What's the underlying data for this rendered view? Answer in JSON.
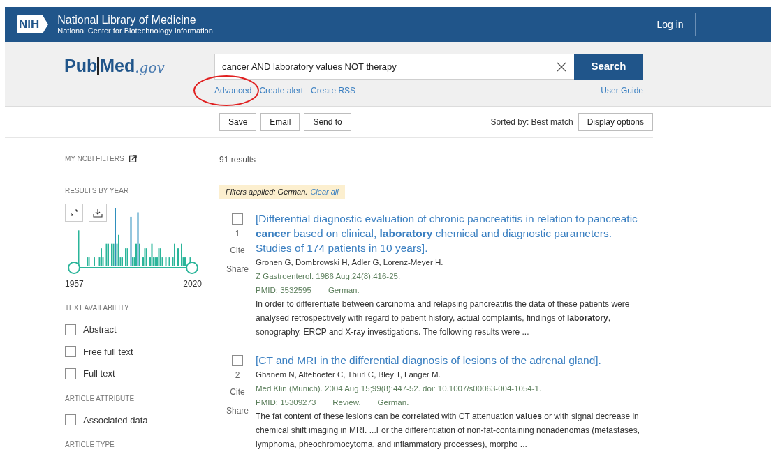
{
  "header": {
    "logo": "NIH",
    "title": "National Library of Medicine",
    "subtitle": "National Center for Biotechnology Information",
    "login": "Log in"
  },
  "search": {
    "logo_main": "Pub",
    "logo_med": "Med",
    "logo_suffix": ".gov",
    "value": "cancer AND laboratory values NOT therapy",
    "button": "Search",
    "links": [
      "Advanced",
      "Create alert",
      "Create RSS"
    ],
    "user_guide": "User Guide"
  },
  "toolbar": {
    "buttons": [
      "Save",
      "Email",
      "Send to"
    ],
    "sorted_by": "Sorted by: Best match",
    "display_options": "Display options"
  },
  "sidebar": {
    "my_filters": "MY NCBI FILTERS",
    "results_by_year": "RESULTS BY YEAR",
    "year_start": "1957",
    "year_end": "2020",
    "sections": [
      {
        "title": "TEXT AVAILABILITY",
        "options": [
          {
            "label": "Abstract",
            "checked": false
          },
          {
            "label": "Free full text",
            "checked": false
          },
          {
            "label": "Full text",
            "checked": false
          }
        ]
      },
      {
        "title": "ARTICLE ATTRIBUTE",
        "options": [
          {
            "label": "Associated data",
            "checked": false
          }
        ]
      },
      {
        "title": "ARTICLE TYPE"
      }
    ]
  },
  "results": {
    "count": "91 results",
    "filters_label": "Filters applied: German.",
    "clear_all": "Clear all",
    "items": [
      {
        "checked": false,
        "number": "1",
        "cite": "Cite",
        "share": "Share",
        "title": "[Differential diagnostic evaluation of chronic pancreatitis in relation to pancreatic **cancer** based on clinical, **laboratory** chemical and diagnostic parameters. Studies of 174 patients in 10 years].",
        "authors": "Gronen G, Dombrowski H, Adler G, Lorenz-Meyer H.",
        "citation": "Z Gastroenterol. 1986 Aug;24(8):416-25.",
        "meta": [
          "PMID: 3532595",
          "German."
        ],
        "snippet": "In order to differentiate between carcinoma and relapsing pancreatitis the data of these patients were analysed retrospectively with regard to patient history, actual complaints, findings of **laboratory**, sonography, ERCP and X-ray investigations. The following results were ..."
      },
      {
        "checked": false,
        "number": "2",
        "cite": "Cite",
        "share": "Share",
        "title": "[CT and MRI in the differential diagnosis of lesions of the adrenal gland].",
        "authors": "Ghanem N, Altehoefer C, Thürl C, Bley T, Langer M.",
        "citation": "Med Klin (Munich). 2004 Aug 15;99(8):447-52. doi: 10.1007/s00063-004-1054-1.",
        "meta": [
          "PMID: 15309273",
          "Review.",
          "German."
        ],
        "snippet": "The fat content of these lesions can be correlated with CT attenuation **values** or with signal decrease in chemical shift imaging in MRI. ...For the differentiation of non-fat-containing nonadenomas (metastases, lymphoma, pheochromocytoma, and inflammatory processes), morpho ..."
      }
    ]
  }
}
